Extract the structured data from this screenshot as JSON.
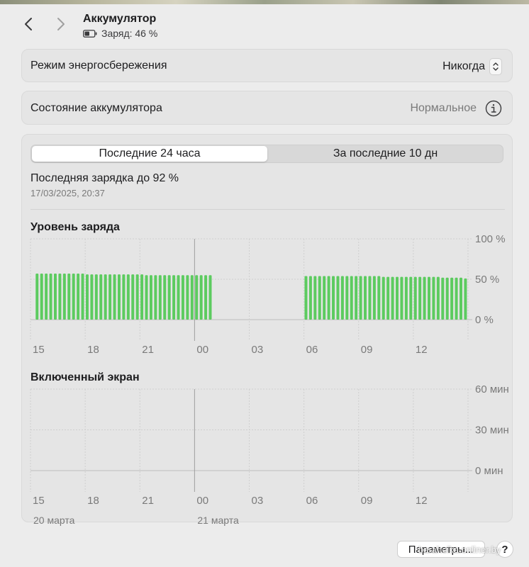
{
  "header": {
    "title": "Аккумулятор",
    "subtitle": "Заряд: 46 %"
  },
  "energy_mode": {
    "label": "Режим энергосбережения",
    "value": "Никогда"
  },
  "battery_health": {
    "label": "Состояние аккумулятора",
    "value": "Нормальное"
  },
  "tabs": [
    {
      "label": "Последние 24 часа",
      "active": true
    },
    {
      "label": "За последние 10 дн",
      "active": false
    }
  ],
  "last_charge": {
    "text": "Последняя зарядка до 92 %",
    "date": "17/03/2025, 20:37"
  },
  "colors": {
    "bar": "#5ccb5f",
    "grid": "#cfcfcf",
    "axis": "#bdbdbd"
  },
  "chart_data": [
    {
      "type": "bar",
      "title": "Уровень заряда",
      "ylim": [
        0,
        100
      ],
      "y_ticks": [
        "100 %",
        "50 %",
        "0 %"
      ],
      "x_ticks": [
        "15",
        "18",
        "21",
        "00",
        "03",
        "06",
        "09",
        "12"
      ],
      "bars_per_hour": 4,
      "slots_total": 96,
      "series": [
        {
          "values": [
            57,
            57,
            57,
            57,
            57,
            57,
            57,
            57,
            57,
            57,
            57,
            56,
            56,
            56,
            56,
            56,
            56,
            56,
            56,
            56,
            56,
            56,
            56,
            56,
            55,
            55,
            55,
            55,
            55,
            55,
            55,
            55,
            55,
            55,
            55,
            55,
            55,
            55,
            55,
            null,
            null,
            null,
            null,
            null,
            null,
            null,
            null,
            null,
            null,
            null,
            null,
            null,
            null,
            null,
            null,
            null,
            null,
            null,
            null,
            54,
            54,
            54,
            54,
            54,
            54,
            54,
            54,
            54,
            54,
            54,
            54,
            54,
            54,
            54,
            54,
            54,
            53,
            53,
            53,
            53,
            53,
            53,
            53,
            53,
            53,
            53,
            53,
            53,
            53,
            52,
            52,
            52,
            52,
            52,
            51,
            null
          ]
        }
      ]
    },
    {
      "type": "bar",
      "title": "Включенный экран",
      "ylim": [
        0,
        60
      ],
      "y_ticks": [
        "60 мин",
        "30 мин",
        "0 мин"
      ],
      "x_ticks": [
        "15",
        "18",
        "21",
        "00",
        "03",
        "06",
        "09",
        "12"
      ],
      "date_labels": [
        "20 марта",
        "21 марта"
      ],
      "series": [
        {
          "values": []
        }
      ]
    }
  ],
  "footer": {
    "params_label": "Параметры...",
    "help_label": "?",
    "watermark": "baraholka.onliner.by"
  }
}
